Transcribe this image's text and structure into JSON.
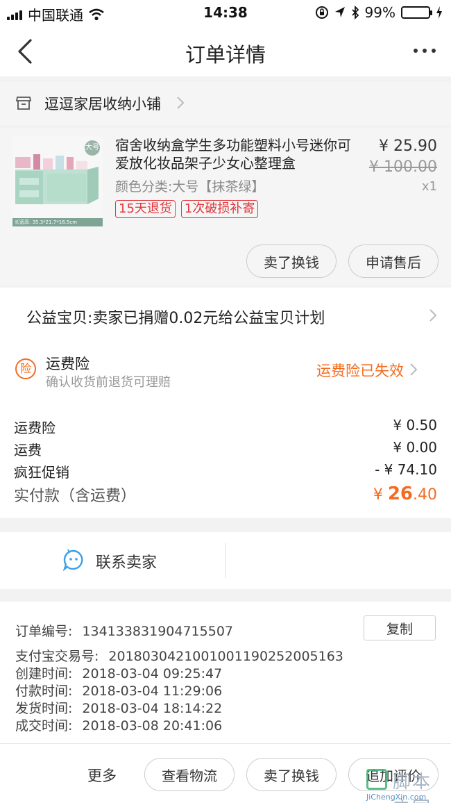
{
  "status_bar": {
    "carrier": "中国联通",
    "time": "14:38",
    "battery": "99%",
    "battery_level": 0.99
  },
  "nav": {
    "title": "订单详情"
  },
  "shop": {
    "name": "逗逗家居收纳小铺"
  },
  "product": {
    "title": "宿舍收纳盒学生多功能塑料小号迷你可爱放化妆品架子少女心整理盒",
    "sku": "颜色分类:大号【抹茶绿】",
    "tags": [
      "15天退货",
      "1次破损补寄"
    ],
    "price": "¥ 25.90",
    "original_price": "¥ 100.00",
    "quantity": "x1",
    "thumb_badge": "大号",
    "thumb_caption": "长宽高: 35.3*21.7*16.5cm",
    "buttons": {
      "sell": "卖了换钱",
      "aftersale": "申请售后"
    }
  },
  "charity": {
    "text": "公益宝贝:卖家已捐赠0.02元给公益宝贝计划"
  },
  "insurance": {
    "icon_text": "险",
    "title": "运费险",
    "subtitle": "确认收货前退货可理赔",
    "status": "运费险已失效"
  },
  "fees": {
    "rows": [
      {
        "label": "运费险",
        "value": "¥ 0.50"
      },
      {
        "label": "运费",
        "value": "¥ 0.00"
      },
      {
        "label": "疯狂促销",
        "value": "- ¥ 74.10"
      }
    ],
    "total_label": "实付款（含运费）",
    "total_currency": "¥",
    "total_int": "26",
    "total_dec": ".40"
  },
  "contact": {
    "label": "联系卖家"
  },
  "order_info": {
    "order_no_label": "订单编号:",
    "order_no": "134133831904715507",
    "copy": "复制",
    "alipay_label": "支付宝交易号:",
    "alipay_no": "2018030421001001190252005163",
    "created_label": "创建时间:",
    "created": "2018-03-04 09:25:47",
    "paid_label": "付款时间:",
    "paid": "2018-03-04 11:29:06",
    "shipped_label": "发货时间:",
    "shipped": "2018-03-04 18:14:22",
    "completed_label": "成交时间:",
    "completed": "2018-03-08 20:41:06"
  },
  "bottom_bar": {
    "more": "更多",
    "logistics": "查看物流",
    "sell": "卖了换钱",
    "review": "追加评价"
  },
  "watermark": {
    "text": "脚本之家",
    "domain": "JiChengXin.com"
  },
  "colors": {
    "accent_orange": "#f36c21",
    "tag_red": "#e0393e",
    "battery_green": "#4cd964",
    "contact_blue": "#3aa0e8"
  }
}
